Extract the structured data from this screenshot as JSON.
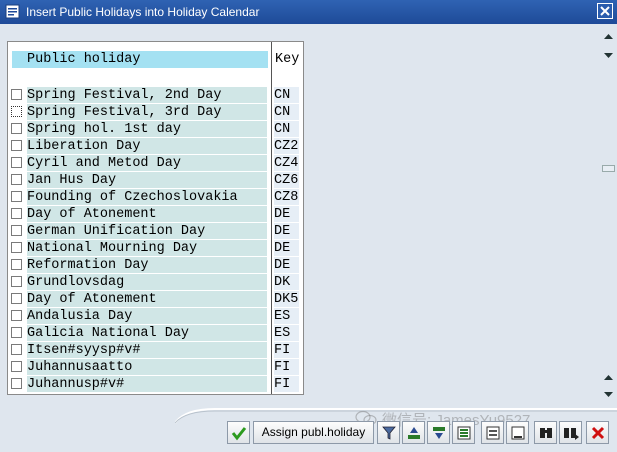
{
  "window": {
    "title": "Insert Public Holidays into Holiday Calendar"
  },
  "table": {
    "header_name": "Public holiday",
    "header_key": "Key",
    "rows": [
      {
        "name": "Spring Festival, 2nd Day",
        "key": "CN"
      },
      {
        "name": "Spring Festival, 3rd Day",
        "key": "CN"
      },
      {
        "name": "Spring hol. 1st day",
        "key": "CN"
      },
      {
        "name": "Liberation Day",
        "key": "CZ2"
      },
      {
        "name": "Cyril and Metod Day",
        "key": "CZ4"
      },
      {
        "name": "Jan Hus Day",
        "key": "CZ6"
      },
      {
        "name": "Founding of Czechoslovakia",
        "key": "CZ8"
      },
      {
        "name": "Day of Atonement",
        "key": "DE"
      },
      {
        "name": "German Unification Day",
        "key": "DE"
      },
      {
        "name": "National Mourning Day",
        "key": "DE"
      },
      {
        "name": "Reformation Day",
        "key": "DE"
      },
      {
        "name": "Grundlovsdag",
        "key": "DK"
      },
      {
        "name": "Day of Atonement",
        "key": "DK5"
      },
      {
        "name": "Andalusia Day",
        "key": "ES"
      },
      {
        "name": "Galicia National Day",
        "key": "ES"
      },
      {
        "name": "Itsen#syysp#v#",
        "key": "FI"
      },
      {
        "name": "Juhannusaatto",
        "key": "FI"
      },
      {
        "name": "Juhannusp#v#",
        "key": "FI"
      }
    ]
  },
  "toolbar": {
    "assign_label": "Assign publ.holiday",
    "icons": [
      "confirm-check-icon",
      "filter-icon",
      "sort-ascending-icon",
      "sort-descending-icon",
      "select-all-icon",
      "select-block-icon",
      "deselect-all-icon",
      "find-icon",
      "find-next-icon",
      "cancel-icon"
    ]
  },
  "watermark": {
    "text": "微信号: JamesYu9527"
  },
  "colors": {
    "titlebar": "#1e4a98",
    "header_fill": "#a4e1f2",
    "name_cell": "#d0e6e6",
    "key_cell": "#e6eef6",
    "background": "#dfe6ee",
    "cancel_red": "#d01010",
    "check_green": "#2c9a1e"
  }
}
